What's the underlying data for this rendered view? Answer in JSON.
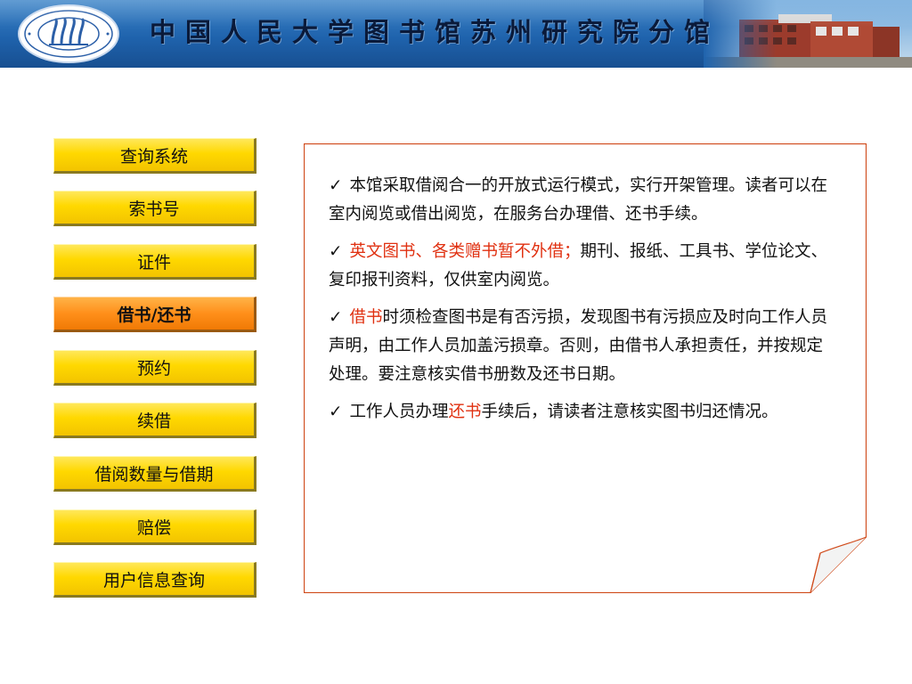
{
  "header": {
    "title": "中国人民大学图书馆苏州研究院分馆",
    "logo_icon": "renmin-university-seal-icon",
    "photo": "library-building-photo"
  },
  "nav": {
    "items": [
      {
        "label": "查询系统",
        "active": false
      },
      {
        "label": "索书号",
        "active": false
      },
      {
        "label": "证件",
        "active": false
      },
      {
        "label": "借书/还书",
        "active": true
      },
      {
        "label": "预约",
        "active": false
      },
      {
        "label": "续借",
        "active": false
      },
      {
        "label": "借阅数量与借期",
        "active": false
      },
      {
        "label": "赔偿",
        "active": false
      },
      {
        "label": "用户信息查询",
        "active": false
      }
    ]
  },
  "content": {
    "check_mark": "✓",
    "p1": {
      "text": "本馆采取借阅合一的开放式运行模式，实行开架管理。读者可以在室内阅览或借出阅览，在服务台办理借、还书手续。"
    },
    "p2": {
      "highlight": "英文图书、各类赠书暂不外借；",
      "rest": "期刊、报纸、工具书、学位论文、复印报刊资料，仅供室内阅览。"
    },
    "p3": {
      "highlight": "借书",
      "rest": "时须检查图书是有否污损，发现图书有污损应及时向工作人员声明，由工作人员加盖污损章。否则，由借书人承担责任，并按规定处理。要注意核实借书册数及还书日期。"
    },
    "p4": {
      "before": "工作人员办理",
      "highlight": "还书",
      "after": "手续后，请读者注意核实图书归还情况。"
    }
  },
  "colors": {
    "banner": "#1f63ad",
    "nav_button": "#ffd800",
    "nav_active": "#ff8f1a",
    "highlight_text": "#e03010",
    "panel_border": "#d04a1a"
  }
}
